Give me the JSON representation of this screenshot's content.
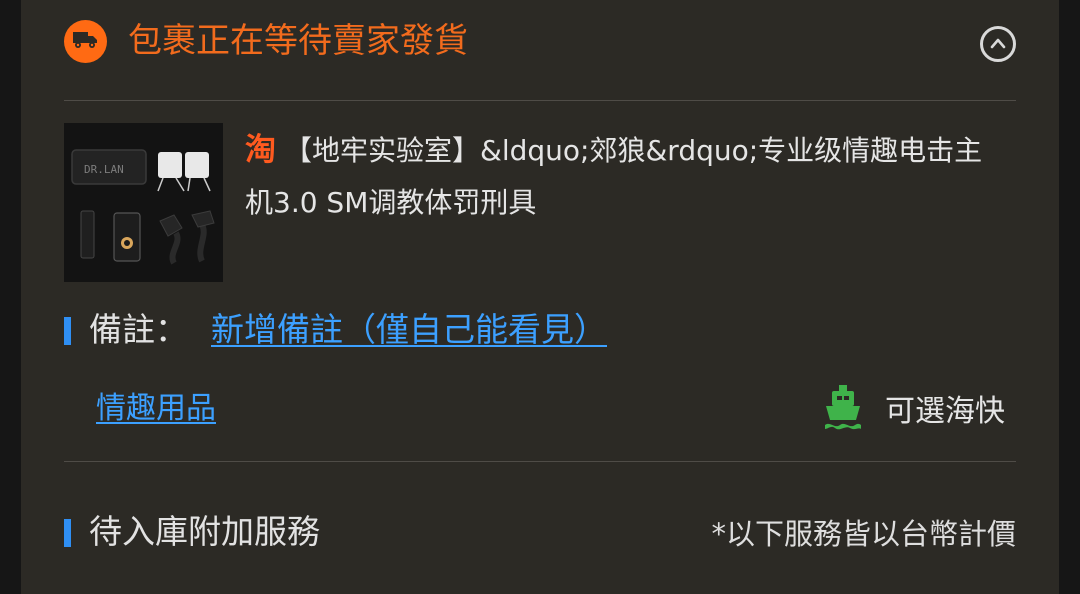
{
  "status": {
    "icon": "truck-icon",
    "text": "包裹正在等待賣家發貨",
    "collapse_icon": "chevron-up-circle-icon",
    "color": "#f26b1d"
  },
  "product": {
    "image_icon": "product-thumbnail",
    "image_label": "DR.LAN",
    "source_mark": "淘",
    "title": "【地牢实验室】&ldquo;郊狼&rdquo;专业级情趣电击主机3.0 SM调教体罚刑具"
  },
  "remark": {
    "label": "備註：",
    "link_text": "新增備註（僅自己能看見）"
  },
  "category": {
    "link_text": "情趣用品"
  },
  "shipping": {
    "icon": "ship-icon",
    "text": "可選海快",
    "icon_color": "#3fb34a"
  },
  "services": {
    "title": "待入庫附加服務",
    "note": "*以下服務皆以台幣計價"
  },
  "colors": {
    "background": "#2c2a25",
    "accent": "#2f8ff4",
    "link": "#3ca0ff",
    "orange": "#ff6a13"
  }
}
